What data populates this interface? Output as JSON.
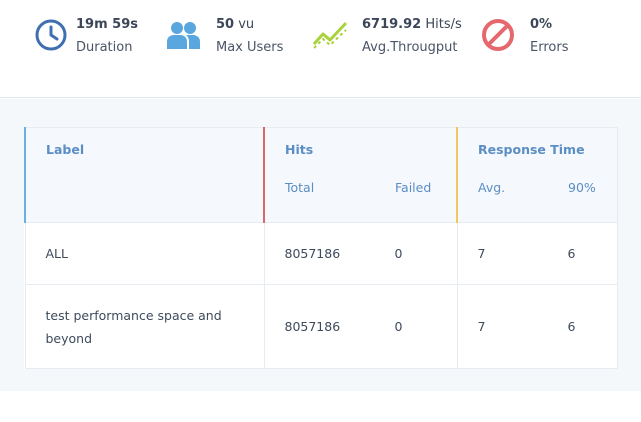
{
  "stats": {
    "duration": {
      "value": "19m 59s",
      "unit": "",
      "label": "Duration",
      "color": "#3f6fb0",
      "icon": "clock-icon"
    },
    "users": {
      "value": "50",
      "unit": "vu",
      "label": "Max Users",
      "color": "#5aa7e0",
      "icon": "users-icon"
    },
    "throughput": {
      "value": "6719.92",
      "unit": "Hits/s",
      "label": "Avg.Througput",
      "color": "#a9d23c",
      "icon": "throughput-chart-icon"
    },
    "errors": {
      "value": "0%",
      "unit": "",
      "label": "Errors",
      "color": "#e5686f",
      "icon": "no-entry-icon"
    }
  },
  "table": {
    "headers": {
      "label": "Label",
      "hits": "Hits",
      "hits_total": "Total",
      "hits_failed": "Failed",
      "response_time": "Response Time",
      "rt_avg": "Avg.",
      "rt_p90": "90%"
    },
    "rows": [
      {
        "label": "ALL",
        "total": "8057186",
        "failed": "0",
        "avg": "7",
        "p90": "6"
      },
      {
        "label": "test performance space and beyond",
        "total": "8057186",
        "failed": "0",
        "avg": "7",
        "p90": "6"
      }
    ]
  }
}
